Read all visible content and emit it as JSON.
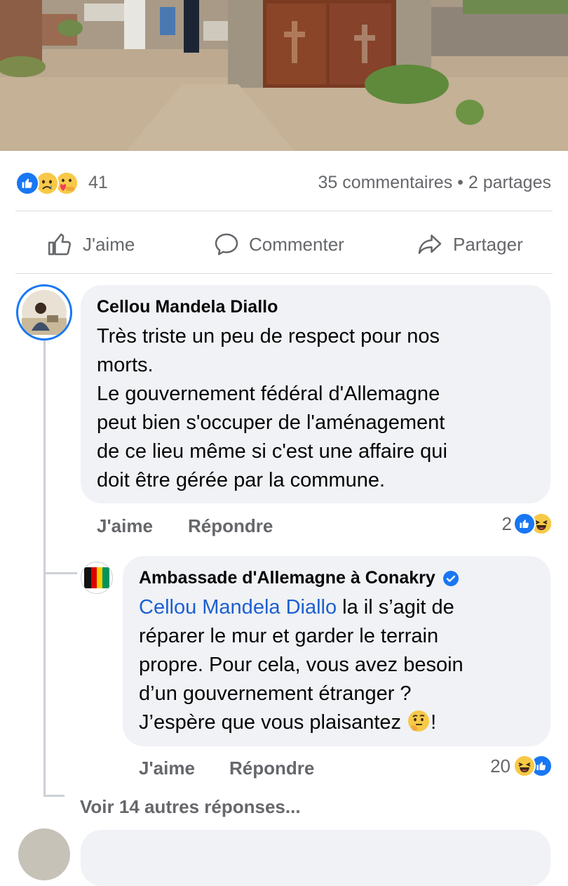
{
  "post": {
    "photo_alt": "Cemetery gate",
    "reactions": {
      "icons": [
        "like-icon",
        "sad-icon",
        "care-icon"
      ],
      "count": "41"
    },
    "comments_shares": "35 commentaires • 2 partages",
    "actions": {
      "like": "J'aime",
      "comment": "Commenter",
      "share": "Partager"
    }
  },
  "comments": [
    {
      "author": "Cellou Mandela Diallo",
      "text_lines": [
        "Très triste un peu de respect pour nos",
        "morts.",
        "Le gouvernement fédéral d'Allemagne",
        "peut bien s'occuper de l'aménagement",
        "de ce lieu même si c'est une affaire qui",
        "doit être gérée par la commune."
      ],
      "like_label": "J'aime",
      "reply_label": "Répondre",
      "reaction_count": "2",
      "reaction_icons": [
        "like-icon",
        "haha-icon"
      ]
    }
  ],
  "replies": [
    {
      "author": "Ambassade d'Allemagne à Conakry",
      "verified": true,
      "mention": "Cellou Mandela Diallo",
      "text_first": " la il s’agit de",
      "text_lines": [
        "réparer le mur et garder le terrain",
        "propre. Pour cela, vous avez besoin",
        "d’un gouvernement étranger ?",
        "J’espère que vous plaisantez"
      ],
      "text_end_emoji": "thinking-face-icon",
      "text_end": "!",
      "like_label": "J'aime",
      "reply_label": "Répondre",
      "reaction_count": "20",
      "reaction_icons": [
        "haha-icon",
        "like-icon"
      ]
    }
  ],
  "more_replies": "Voir 14 autres réponses...",
  "colors": {
    "accent": "#1877f2",
    "mention": "#1c5fd1",
    "secondary_text": "#65676b",
    "bubble": "#f0f2f5"
  }
}
